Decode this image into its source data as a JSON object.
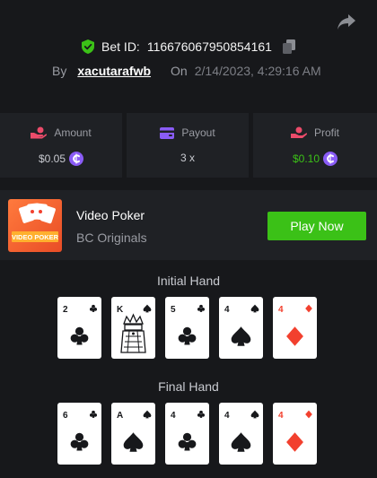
{
  "header": {
    "bet_label": "Bet ID:",
    "bet_id": "116676067950854161",
    "by_label": "By",
    "user": "xacutarafwb",
    "on_label": "On",
    "date": "2/14/2023, 4:29:16 AM"
  },
  "stats": [
    {
      "label": "Amount",
      "value": "$0.05",
      "icon": "coins-hand-icon",
      "currency_icon": true,
      "color": "#c8cad0"
    },
    {
      "label": "Payout",
      "value": "3 x",
      "icon": "wallet-icon",
      "currency_icon": false,
      "color": "#c8cad0"
    },
    {
      "label": "Profit",
      "value": "$0.10",
      "icon": "hand-coin-icon",
      "currency_icon": true,
      "color": "#3bc117"
    }
  ],
  "game": {
    "title": "Video Poker",
    "subtitle": "BC Originals",
    "play_label": "Play Now",
    "logo_text": "VIDEO POKER"
  },
  "hands": {
    "initial_title": "Initial Hand",
    "final_title": "Final Hand",
    "initial": [
      {
        "rank": "2",
        "suit": "clubs"
      },
      {
        "rank": "K",
        "suit": "spades"
      },
      {
        "rank": "5",
        "suit": "clubs"
      },
      {
        "rank": "4",
        "suit": "spades"
      },
      {
        "rank": "4",
        "suit": "diamonds"
      }
    ],
    "final": [
      {
        "rank": "6",
        "suit": "clubs"
      },
      {
        "rank": "A",
        "suit": "spades"
      },
      {
        "rank": "4",
        "suit": "clubs"
      },
      {
        "rank": "4",
        "suit": "spades"
      },
      {
        "rank": "4",
        "suit": "diamonds"
      }
    ]
  },
  "colors": {
    "background": "#17181b",
    "panel": "#1f2125",
    "accent_green": "#3bc117",
    "accent_pink": "#ec4b6a",
    "accent_purple": "#8a5cf6",
    "diamond_red": "#f2402e"
  }
}
